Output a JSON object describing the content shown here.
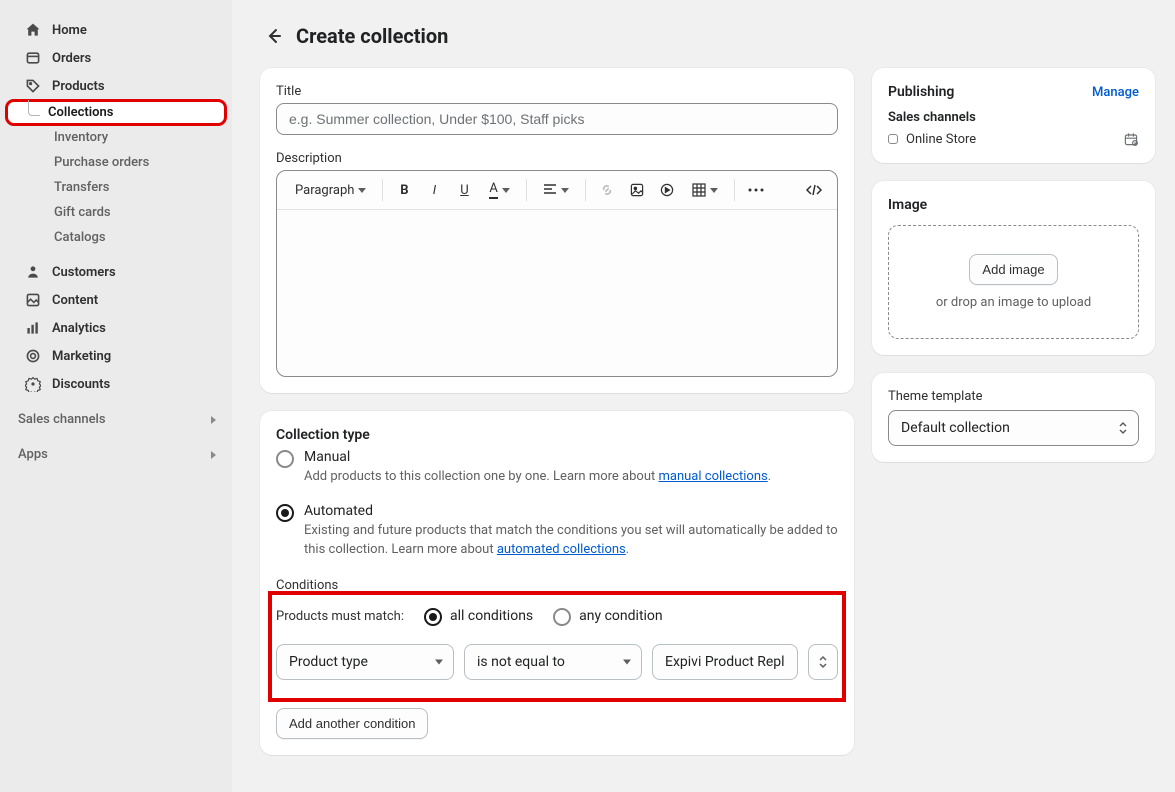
{
  "sidebar": {
    "items": [
      {
        "label": "Home"
      },
      {
        "label": "Orders"
      },
      {
        "label": "Products"
      },
      {
        "label": "Customers"
      },
      {
        "label": "Content"
      },
      {
        "label": "Analytics"
      },
      {
        "label": "Marketing"
      },
      {
        "label": "Discounts"
      }
    ],
    "products_sub": [
      {
        "label": "Collections"
      },
      {
        "label": "Inventory"
      },
      {
        "label": "Purchase orders"
      },
      {
        "label": "Transfers"
      },
      {
        "label": "Gift cards"
      },
      {
        "label": "Catalogs"
      }
    ],
    "sections": {
      "sales_channels": "Sales channels",
      "apps": "Apps"
    }
  },
  "page": {
    "title": "Create collection"
  },
  "form": {
    "title_label": "Title",
    "title_placeholder": "e.g. Summer collection, Under $100, Staff picks",
    "description_label": "Description",
    "rte": {
      "paragraph": "Paragraph"
    }
  },
  "collection_type": {
    "heading": "Collection type",
    "manual": {
      "label": "Manual",
      "help_pre": "Add products to this collection one by one. Learn more about ",
      "help_link": "manual collections",
      "help_post": "."
    },
    "automated": {
      "label": "Automated",
      "help_pre": "Existing and future products that match the conditions you set will automatically be added to this collection. Learn more about ",
      "help_link": "automated collections",
      "help_post": "."
    }
  },
  "conditions": {
    "heading": "Conditions",
    "match_label": "Products must match:",
    "all": "all conditions",
    "any": "any condition",
    "row": {
      "field": "Product type",
      "operator": "is not equal to",
      "value": "Expivi Product Repl"
    },
    "add_btn": "Add another condition"
  },
  "publishing": {
    "heading": "Publishing",
    "manage": "Manage",
    "sales_channels_label": "Sales channels",
    "online_store": "Online Store"
  },
  "image": {
    "heading": "Image",
    "add_btn": "Add image",
    "drop_help": "or drop an image to upload"
  },
  "theme": {
    "heading": "Theme template",
    "value": "Default collection"
  }
}
